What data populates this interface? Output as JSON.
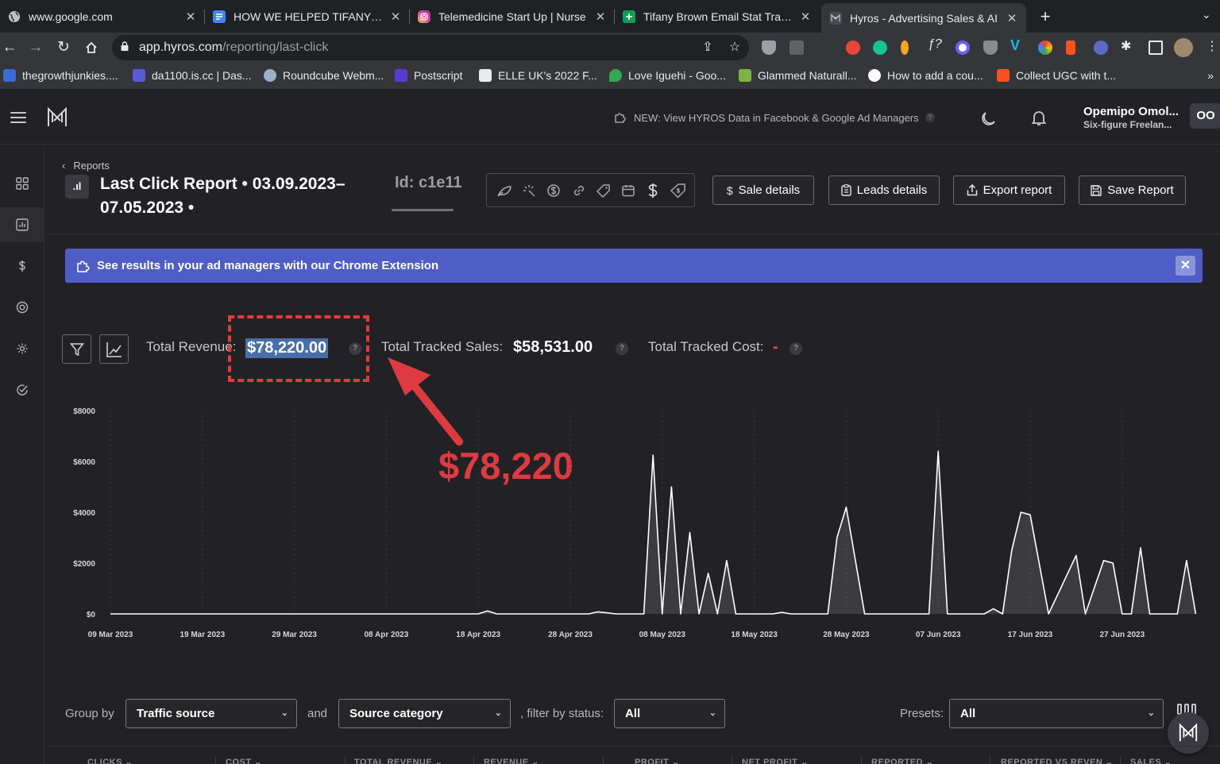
{
  "browser": {
    "tabs": [
      {
        "label": "www.google.com",
        "icon": "globe-icon",
        "color": "#5f6368"
      },
      {
        "label": "HOW WE HELPED TIFANY BRO",
        "icon": "docs-icon",
        "color": "#4285f4"
      },
      {
        "label": "Telemedicine Start Up | Nurse",
        "icon": "instagram-icon",
        "color": "#d6249f"
      },
      {
        "label": "Tifany Brown Email Stat Trackir",
        "icon": "sheets-icon",
        "color": "#0f9d58"
      },
      {
        "label": "Hyros - Advertising Sales & AI",
        "icon": "hyros-icon",
        "color": "#3c3c44"
      }
    ],
    "url_host": "app.hyros.com",
    "url_path": "/reporting/last-click",
    "bookmarks": [
      {
        "label": "thegrowthjunkies....",
        "color": "#3b6bd6"
      },
      {
        "label": "da1100.is.cc | Das...",
        "color": "#5a5ad6"
      },
      {
        "label": "Roundcube Webm...",
        "color": "#9ab0c8"
      },
      {
        "label": "Postscript",
        "color": "#5a3ad6"
      },
      {
        "label": "ELLE UK's 2022 F...",
        "color": "#e8eaed"
      },
      {
        "label": "Love Iguehi - Goo...",
        "color": "#34a853"
      },
      {
        "label": "Glammed Naturall...",
        "color": "#7cb342"
      },
      {
        "label": "How to add a cou...",
        "color": "#ffffff"
      },
      {
        "label": "Collect UGC with t...",
        "color": "#f4511e"
      }
    ],
    "bookmarks_more": "»"
  },
  "header": {
    "promo": "NEW: View HYROS Data in Facebook & Google Ad Managers",
    "promo_help": "?",
    "user_name": "Opemipo Omol...",
    "user_sub": "Six-figure Freelan...",
    "avatar": "OO"
  },
  "report": {
    "breadcrumb": "Reports",
    "icon_text": ".ıl",
    "title": "Last Click Report • 03.09.2023–07.05.2023 •",
    "id": "Id: c1e11",
    "actions": {
      "sale_details": "Sale details",
      "leads_details": "Leads details",
      "export_report": "Export report",
      "save_report": "Save Report"
    }
  },
  "banner": {
    "text": "See results in your ad managers with our Chrome Extension",
    "close": "✕"
  },
  "stats": {
    "revenue_label": "Total Revenue:",
    "revenue_value": "$78,220.00",
    "tracked_sales_label": "Total Tracked Sales:",
    "tracked_sales_value": "$58,531.00",
    "tracked_cost_label": "Total Tracked Cost:",
    "tracked_cost_value": "-",
    "help": "?"
  },
  "annotation": {
    "text": "$78,220",
    "color": "#dd3b3f"
  },
  "chart_data": {
    "type": "area",
    "y_ticks": [
      "$0",
      "$2000",
      "$4000",
      "$6000",
      "$8000"
    ],
    "ylim": [
      0,
      8000
    ],
    "x_ticks": [
      "09 Mar 2023",
      "19 Mar 2023",
      "29 Mar 2023",
      "08 Apr 2023",
      "18 Apr 2023",
      "28 Apr 2023",
      "08 May 2023",
      "18 May 2023",
      "28 May 2023",
      "07 Jun 2023",
      "17 Jun 2023",
      "27 Jun 2023"
    ],
    "x_start": "2023-03-09",
    "grid": true,
    "series": [
      {
        "color": "#ffffff",
        "points": [
          [
            "2023-03-09",
            0
          ],
          [
            "2023-04-18",
            0
          ],
          [
            "2023-04-19",
            120
          ],
          [
            "2023-04-20",
            0
          ],
          [
            "2023-04-30",
            0
          ],
          [
            "2023-05-01",
            80
          ],
          [
            "2023-05-03",
            0
          ],
          [
            "2023-05-06",
            0
          ],
          [
            "2023-05-07",
            6250
          ],
          [
            "2023-05-08",
            0
          ],
          [
            "2023-05-09",
            5000
          ],
          [
            "2023-05-10",
            0
          ],
          [
            "2023-05-11",
            3200
          ],
          [
            "2023-05-12",
            0
          ],
          [
            "2023-05-13",
            1600
          ],
          [
            "2023-05-14",
            0
          ],
          [
            "2023-05-15",
            2100
          ],
          [
            "2023-05-16",
            0
          ],
          [
            "2023-05-20",
            0
          ],
          [
            "2023-05-21",
            60
          ],
          [
            "2023-05-22",
            0
          ],
          [
            "2023-05-26",
            0
          ],
          [
            "2023-05-27",
            3000
          ],
          [
            "2023-05-28",
            4200
          ],
          [
            "2023-05-30",
            0
          ],
          [
            "2023-06-06",
            0
          ],
          [
            "2023-06-07",
            6400
          ],
          [
            "2023-06-08",
            0
          ],
          [
            "2023-06-12",
            0
          ],
          [
            "2023-06-13",
            200
          ],
          [
            "2023-06-14",
            0
          ],
          [
            "2023-06-15",
            2500
          ],
          [
            "2023-06-16",
            4000
          ],
          [
            "2023-06-17",
            3900
          ],
          [
            "2023-06-19",
            0
          ],
          [
            "2023-06-22",
            2300
          ],
          [
            "2023-06-23",
            0
          ],
          [
            "2023-06-25",
            2100
          ],
          [
            "2023-06-26",
            2000
          ],
          [
            "2023-06-27",
            0
          ],
          [
            "2023-06-28",
            0
          ],
          [
            "2023-06-29",
            2600
          ],
          [
            "2023-06-30",
            0
          ],
          [
            "2023-07-03",
            0
          ],
          [
            "2023-07-04",
            2100
          ],
          [
            "2023-07-05",
            0
          ],
          [
            "2023-07-06",
            300
          ],
          [
            "2023-07-07",
            0
          ]
        ]
      }
    ]
  },
  "controls": {
    "group_by": "Group by",
    "and": "and",
    "filter_status": ", filter by status:",
    "group_value": "Traffic source",
    "group2_value": "Source category",
    "status_value": "All",
    "presets_label": "Presets:",
    "presets_value": "All"
  },
  "table_headers": [
    "CLICKS",
    "COST",
    "TOTAL REVENUE",
    "REVENUE",
    "PROFIT",
    "NET PROFIT",
    "REPORTED",
    "REPORTED VS REVEN",
    "SALES"
  ]
}
